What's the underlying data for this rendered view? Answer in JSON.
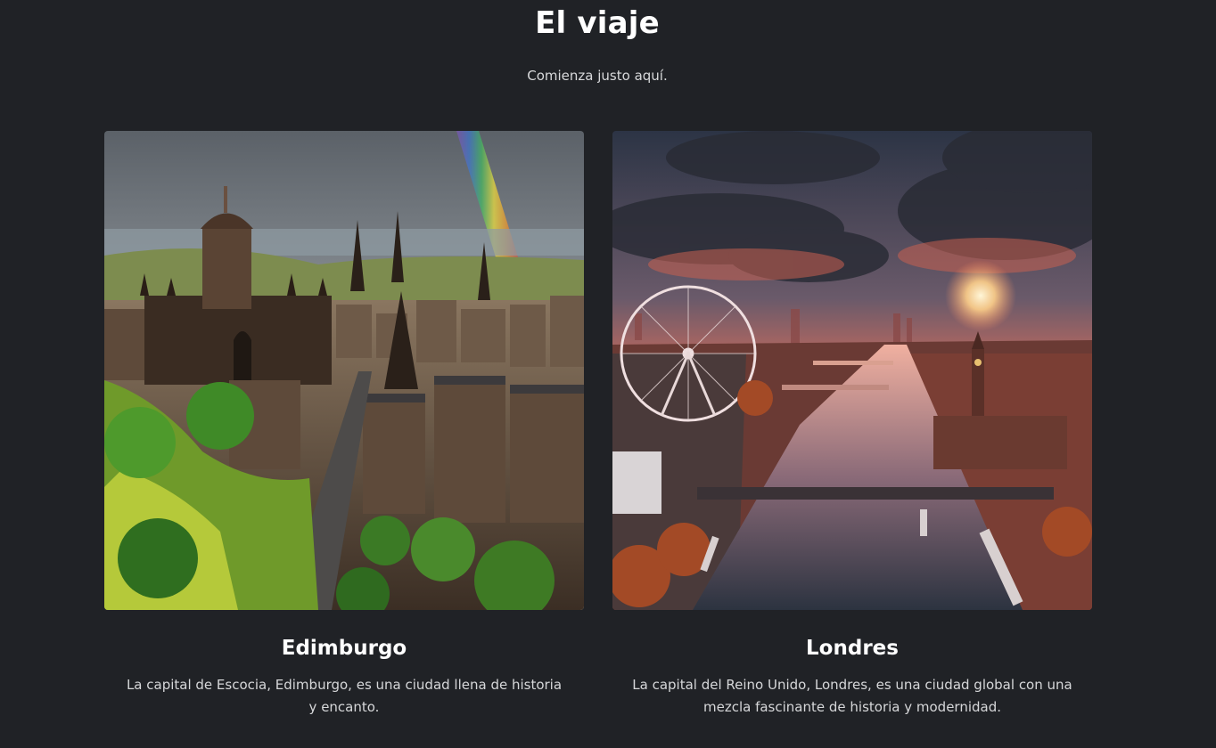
{
  "header": {
    "title": "El viaje",
    "subtitle": "Comienza justo aquí."
  },
  "cards": [
    {
      "title": "Edimburgo",
      "description": "La capital de Escocia, Edimburgo, es una ciudad llena de historia y encanto.",
      "image": "edinburgh-cityscape-rainbow-photo"
    },
    {
      "title": "Londres",
      "description": "La capital del Reino Unido, Londres, es una ciudad global con una mezcla fascinante de historia y modernidad.",
      "image": "london-eye-thames-sunset-photo"
    }
  ],
  "colors": {
    "background": "#202226",
    "heading": "#ffffff",
    "body_text": "#d6d7d9"
  }
}
